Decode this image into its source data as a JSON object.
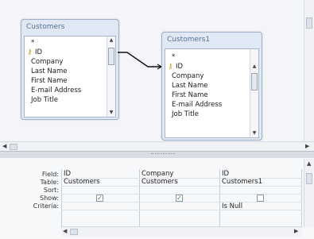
{
  "design_view": {
    "tables": [
      {
        "title": "Customers",
        "fields": [
          "*",
          "ID",
          "Company",
          "Last Name",
          "First Name",
          "E-mail Address",
          "Job Title"
        ]
      },
      {
        "title": "Customers1",
        "fields": [
          "*",
          "ID",
          "Company",
          "Last Name",
          "First Name",
          "E-mail Address",
          "Job Title"
        ]
      }
    ]
  },
  "grid": {
    "row_labels": [
      "Field:",
      "Table:",
      "Sort:",
      "Show:",
      "Criteria:"
    ],
    "columns": [
      {
        "field": "ID",
        "table": "Customers",
        "sort": "",
        "show": true,
        "criteria": ""
      },
      {
        "field": "Company",
        "table": "Customers",
        "sort": "",
        "show": true,
        "criteria": ""
      },
      {
        "field": "ID",
        "table": "Customers1",
        "sort": "",
        "show": false,
        "criteria": "Is Null"
      }
    ]
  },
  "icons": {
    "primary_key": "key-icon",
    "join_line": "relationship-line",
    "check": "checkbox-check"
  },
  "colors": {
    "window_bg": "#dfe8f4",
    "key": "#c9a227"
  }
}
